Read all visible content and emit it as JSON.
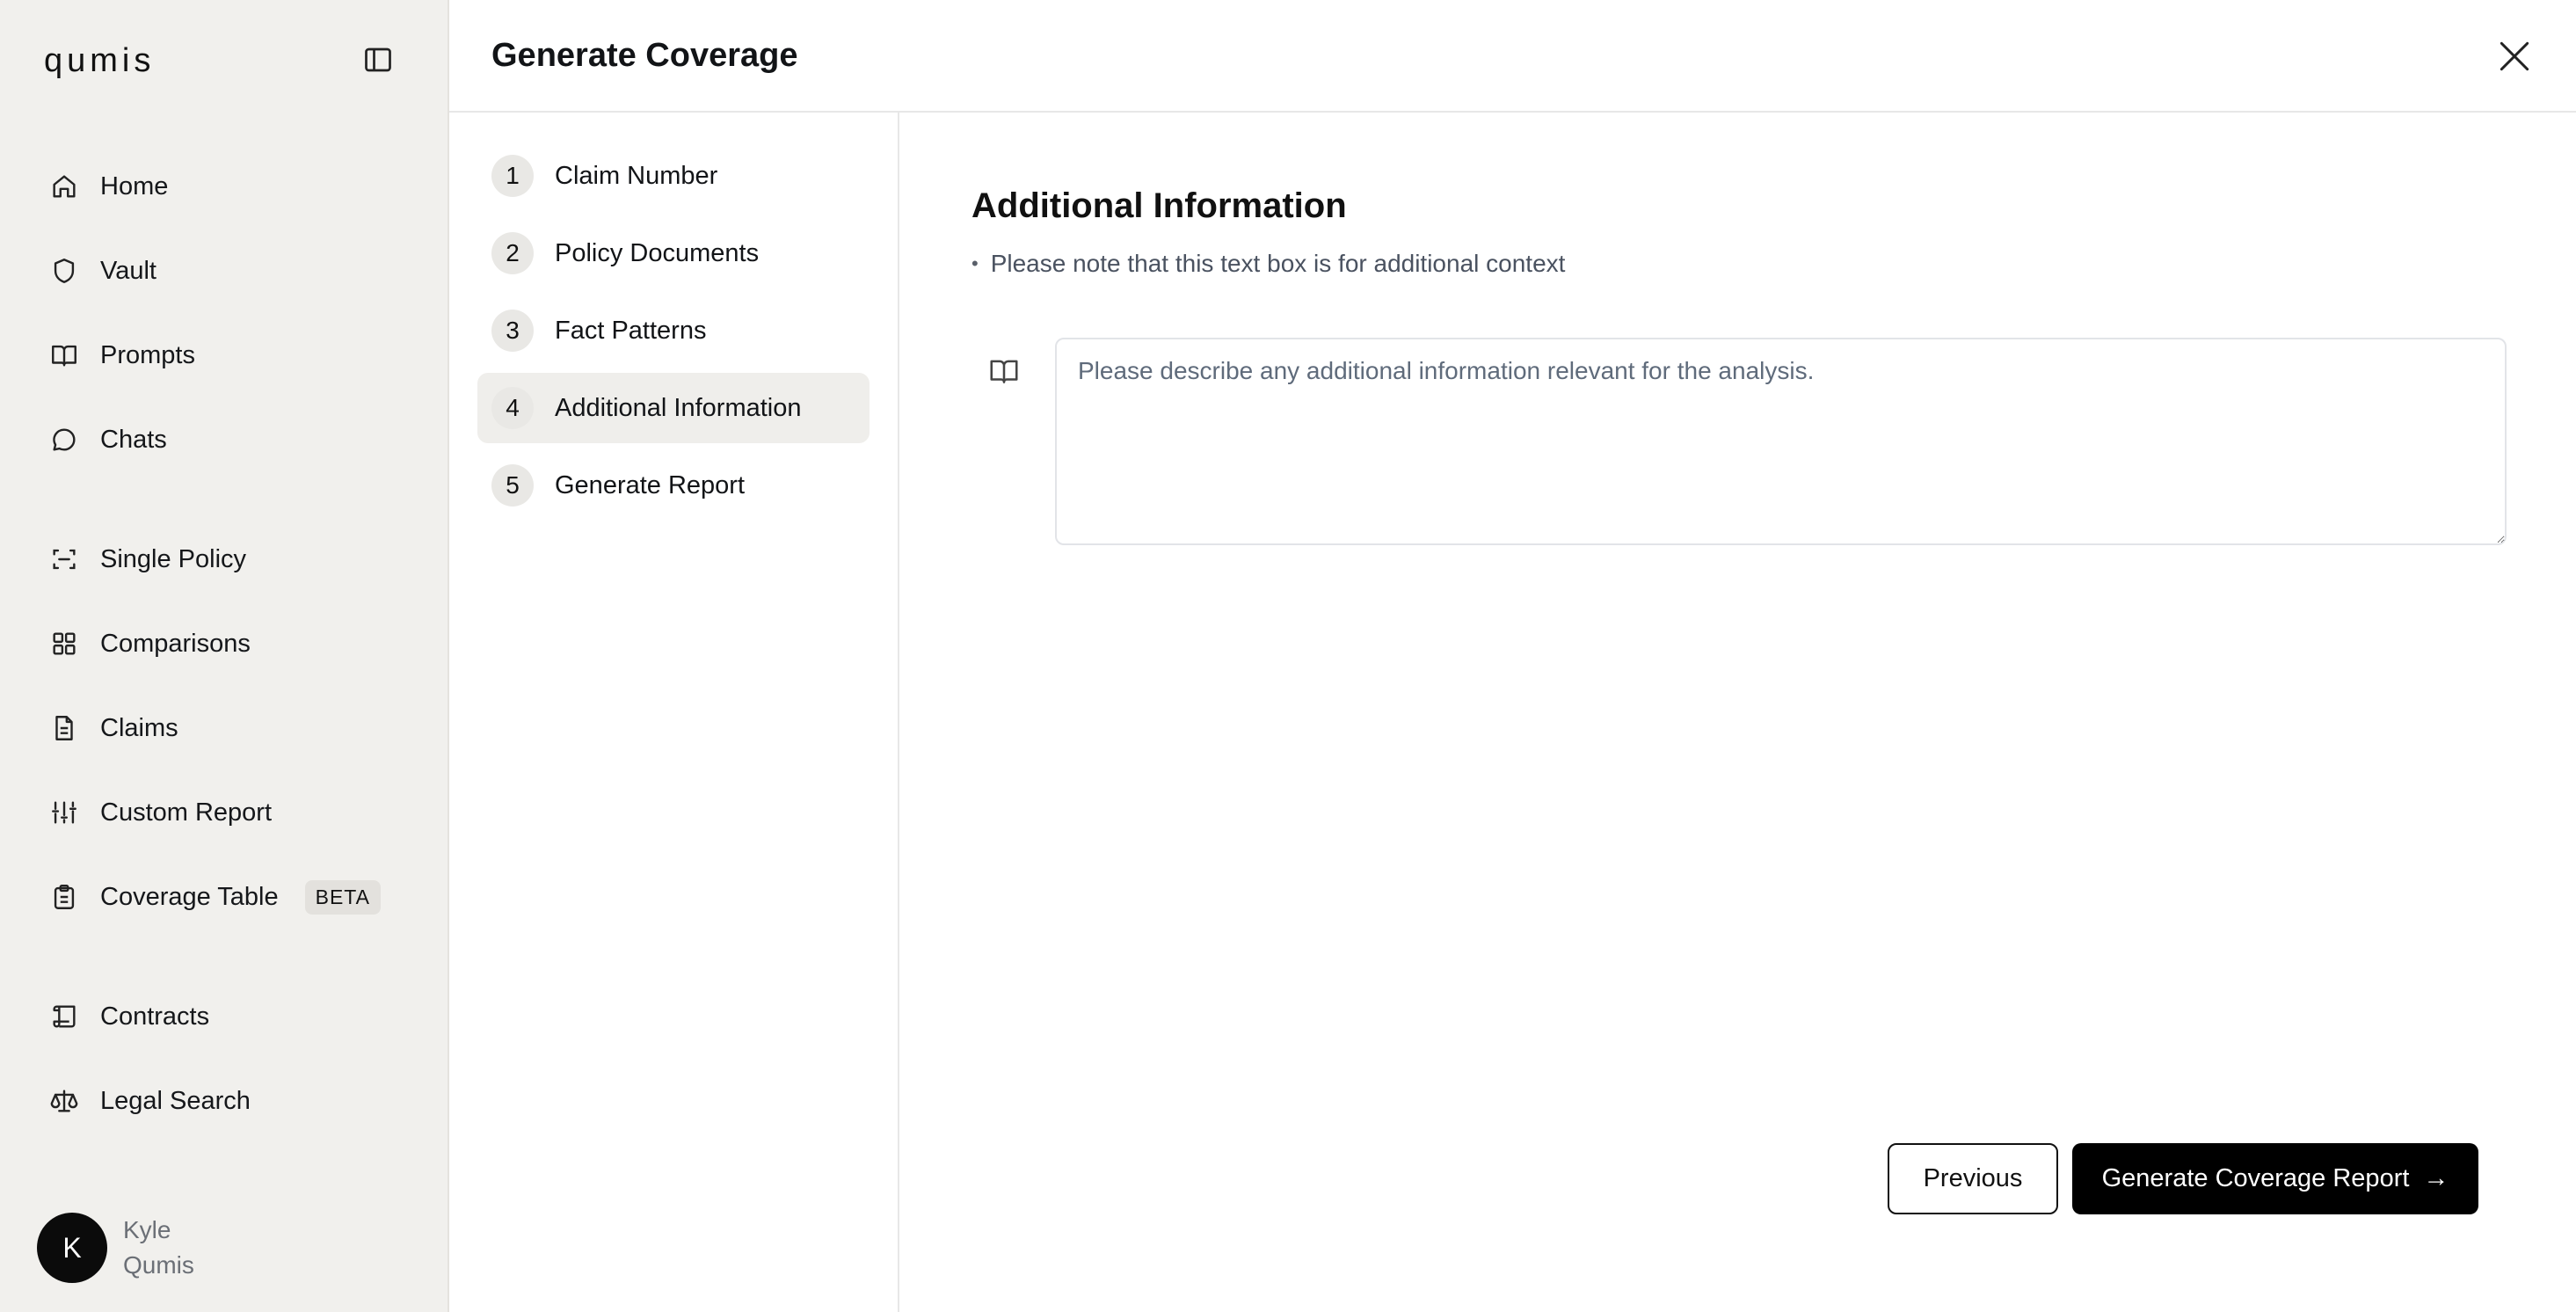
{
  "sidebar": {
    "logo": "qumis",
    "items": [
      {
        "label": "Home",
        "icon": "home-icon"
      },
      {
        "label": "Vault",
        "icon": "shield-icon"
      },
      {
        "label": "Prompts",
        "icon": "book-open-icon"
      },
      {
        "label": "Chats",
        "icon": "chat-bubble-icon"
      },
      {
        "label": "Single Policy",
        "icon": "scan-icon"
      },
      {
        "label": "Comparisons",
        "icon": "grid-icon"
      },
      {
        "label": "Claims",
        "icon": "document-icon"
      },
      {
        "label": "Custom Report",
        "icon": "sliders-icon"
      },
      {
        "label": "Coverage Table",
        "icon": "clipboard-icon",
        "badge": "BETA"
      },
      {
        "label": "Contracts",
        "icon": "scroll-icon"
      },
      {
        "label": "Legal Search",
        "icon": "scale-icon"
      }
    ],
    "user": {
      "initial": "K",
      "first_name": "Kyle",
      "last_name": "Qumis"
    }
  },
  "header": {
    "title": "Generate Coverage"
  },
  "steps": [
    {
      "number": "1",
      "label": "Claim Number"
    },
    {
      "number": "2",
      "label": "Policy Documents"
    },
    {
      "number": "3",
      "label": "Fact Patterns"
    },
    {
      "number": "4",
      "label": "Additional Information",
      "active": true
    },
    {
      "number": "5",
      "label": "Generate Report"
    }
  ],
  "main": {
    "title": "Additional Information",
    "note": "Please note that this text box is for additional context",
    "textarea": {
      "value": "",
      "placeholder": "Please describe any additional information relevant for the analysis."
    },
    "previous_label": "Previous",
    "generate_label": "Generate Coverage Report",
    "generate_arrow": "→"
  }
}
